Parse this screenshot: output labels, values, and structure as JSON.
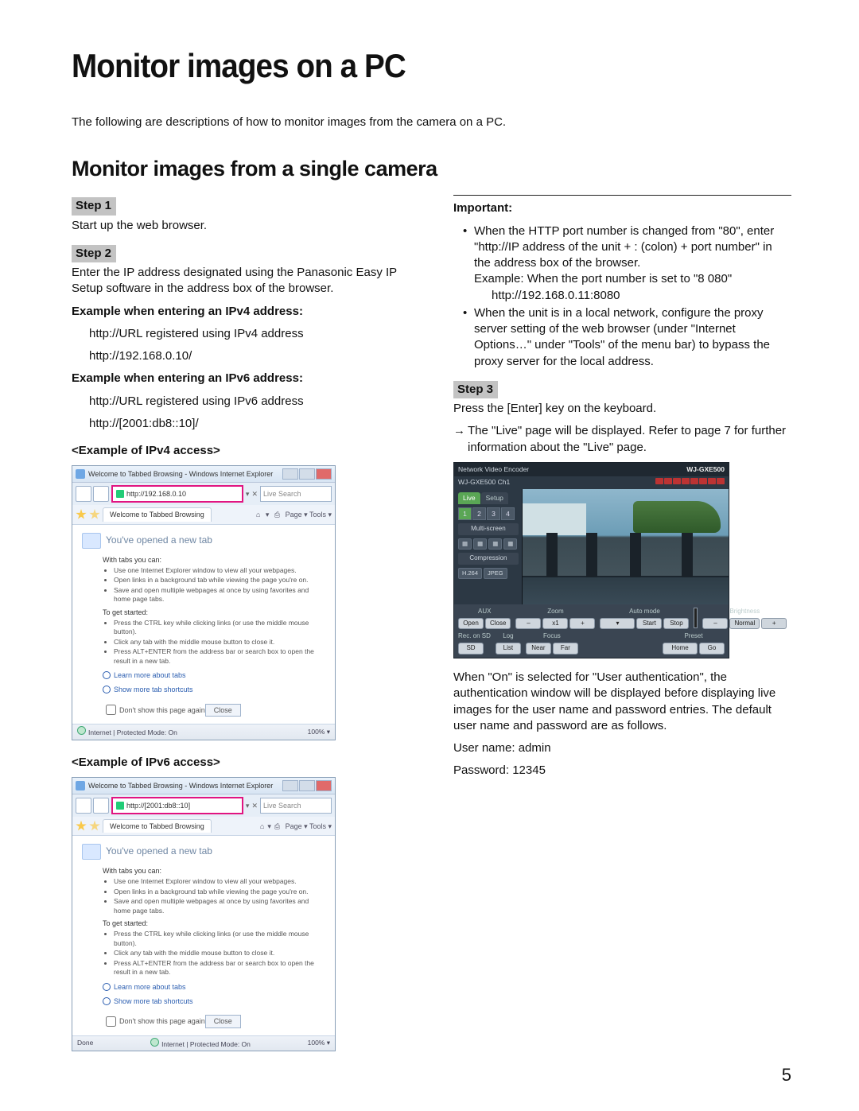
{
  "title": "Monitor images on a PC",
  "intro": "The following are descriptions of how to monitor images from the camera on a PC.",
  "subtitle": "Monitor images from a single camera",
  "steps": {
    "s1": {
      "head": "Step 1",
      "body": "Start up the web browser."
    },
    "s2": {
      "head": "Step 2",
      "body": "Enter the IP address designated using the Panasonic Easy IP Setup software in the address box of the browser."
    },
    "s3": {
      "head": "Step 3",
      "body": "Press the [Enter] key on the keyboard.",
      "arrow": "→",
      "arrow_body": "The \"Live\" page will be displayed. Refer to page 7 for further information about the \"Live\" page."
    }
  },
  "ipv4": {
    "head": "Example when entering an IPv4 address:",
    "line1": "http://URL registered using IPv4 address",
    "line2": "http://192.168.0.10/",
    "caption": "<Example of IPv4 access>"
  },
  "ipv6": {
    "head": "Example when entering an IPv6 address:",
    "line1": "http://URL registered using IPv6 address",
    "line2": "http://[2001:db8::10]/",
    "caption": "<Example of IPv6 access>"
  },
  "important": {
    "head": "Important:",
    "b1a": "When the HTTP port number is changed from \"80\", enter \"http://IP address of the unit + : (colon) + port number\" in the address box of the browser.",
    "b1b": "Example: When the port number is set to \"8 080\"",
    "b1c": "http://192.168.0.11:8080",
    "b2": "When the unit is in a local network, configure the proxy server setting of the web browser (under \"Internet Options…\" under \"Tools\" of the menu bar) to bypass the proxy server for the local address."
  },
  "auth": {
    "p1": "When \"On\" is selected for \"User authentication\", the authentication window will be displayed before displaying live images for the user name and password entries. The default user name and password are as follows.",
    "user_line": "User name:  admin",
    "pass_line": "Password:   12345"
  },
  "page_number": "5",
  "browser": {
    "title": "Welcome to Tabbed Browsing - Windows Internet Explorer",
    "url_ipv4": "http://192.168.0.10",
    "url_ipv6": "http://[2001:db8::10]",
    "search_placeholder": "Live Search",
    "tab_label": "Welcome to Tabbed Browsing",
    "tools": "Page ▾   Tools ▾",
    "newtab_heading": "You've opened a new tab",
    "sec1_label": "With tabs you can:",
    "sec1_li1": "Use one Internet Explorer window to view all your webpages.",
    "sec1_li2": "Open links in a background tab while viewing the page you're on.",
    "sec1_li3": "Save and open multiple webpages at once by using favorites and home page tabs.",
    "sec2_label": "To get started:",
    "sec2_li1": "Press the CTRL key while clicking links (or use the middle mouse button).",
    "sec2_li2": "Click any tab with the middle mouse button to close it.",
    "sec2_li3": "Press ALT+ENTER from the address bar or search box to open the result in a new tab.",
    "link1": "Learn more about tabs",
    "link2": "Show more tab shortcuts",
    "check_label": "Don't show this page again",
    "close_btn": "Close",
    "status_left": "Done",
    "status_mid": "Internet | Protected Mode: On",
    "status_right": "100%  ▾"
  },
  "live": {
    "brand": "Network Video Encoder",
    "model": "WJ-GXE500",
    "ch_title": "WJ-GXE500  Ch1",
    "tab_live": "Live",
    "tab_setup": "Setup",
    "ch": [
      "1",
      "2",
      "3",
      "4"
    ],
    "multi": "Multi-screen",
    "compression": "Compression",
    "h264": "H.264",
    "jpeg": "JPEG",
    "aux": "AUX",
    "open": "Open",
    "close": "Close",
    "recsd": "Rec. on SD",
    "sd": "SD",
    "log": "Log",
    "list": "List",
    "zoom": "Zoom",
    "focus": "Focus",
    "near": "Near",
    "far": "Far",
    "automode": "Auto mode",
    "start": "Start",
    "stop": "Stop",
    "brightness": "Brightness",
    "normal": "Normal",
    "preset": "Preset",
    "home": "Home",
    "go": "Go",
    "plus": "+",
    "minus": "–",
    "x1": "x1"
  }
}
